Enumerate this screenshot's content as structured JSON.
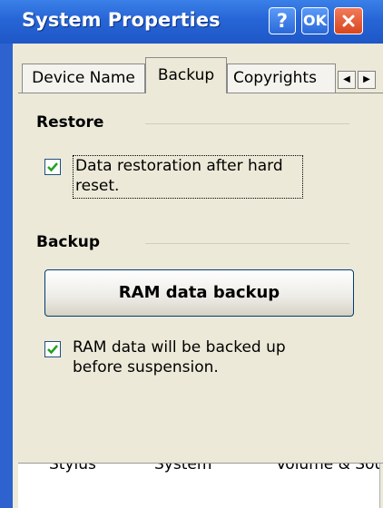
{
  "window": {
    "title": "System Properties",
    "help_label": "?",
    "ok_label": "OK",
    "close_label": "×"
  },
  "tabs": [
    {
      "label": "Device Name",
      "selected": false
    },
    {
      "label": "Backup",
      "selected": true
    },
    {
      "label": "Copyrights",
      "selected": false
    }
  ],
  "tab_scroll": {
    "left": "◀",
    "right": "▶"
  },
  "restore": {
    "title": "Restore",
    "checkbox_label": "Data restoration after hard reset.",
    "checked": true
  },
  "backup": {
    "title": "Backup",
    "button_label": "RAM data backup",
    "checkbox_label": "RAM data will be backed up before suspension.",
    "checked": true
  },
  "bottom_items": [
    "Stylus",
    "System",
    "Volume & Sounds"
  ],
  "bottom_scroll": {
    "down": "▼"
  },
  "colors": {
    "titlebar": "#2765d6",
    "dialog": "#ece9d8",
    "check": "#21a121"
  }
}
